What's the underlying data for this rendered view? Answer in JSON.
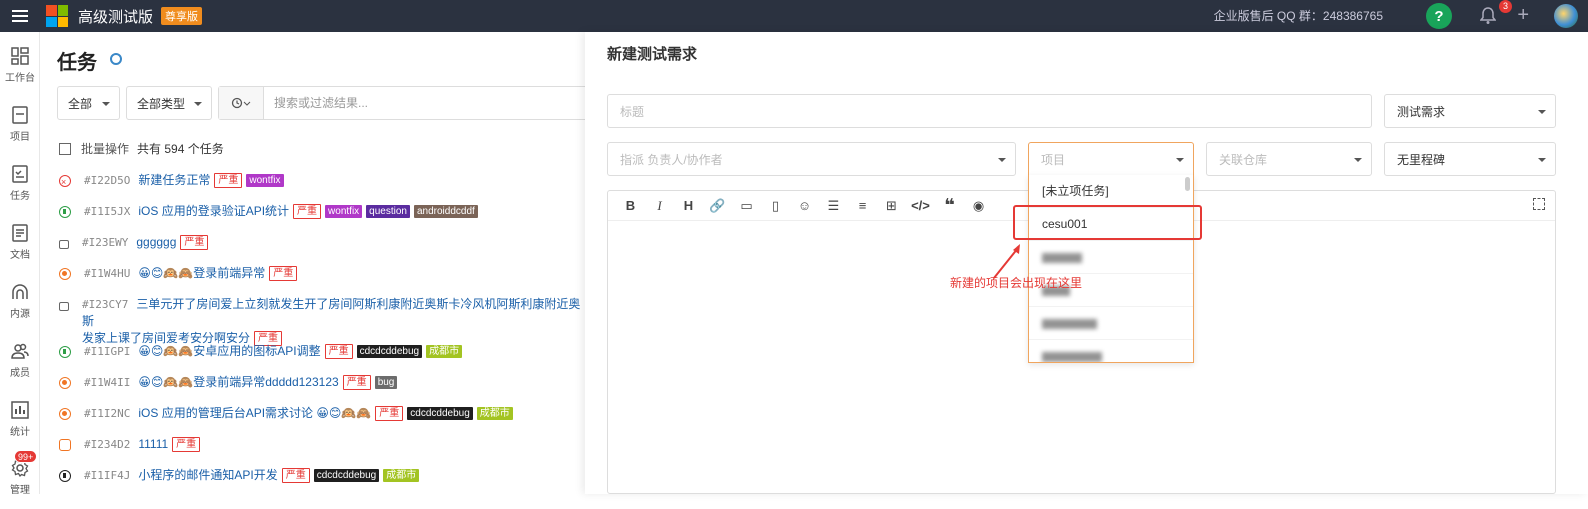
{
  "topbar": {
    "title": "高级测试版",
    "edition": "尊享版",
    "support": "企业版售后 QQ 群：248386765",
    "help": "?",
    "notifications": "3",
    "add": "+"
  },
  "sidebar": {
    "items": [
      {
        "label": "工作台",
        "icon": "dashboard-icon"
      },
      {
        "label": "项目",
        "icon": "project-icon"
      },
      {
        "label": "任务",
        "icon": "task-icon"
      },
      {
        "label": "文档",
        "icon": "doc-icon"
      },
      {
        "label": "内源",
        "icon": "innersource-icon"
      },
      {
        "label": "成员",
        "icon": "members-icon"
      },
      {
        "label": "统计",
        "icon": "stats-icon"
      },
      {
        "label": "管理",
        "icon": "gear-icon",
        "badge": "99+"
      }
    ]
  },
  "main": {
    "title": "任务",
    "filter_scope": "全部",
    "filter_type": "全部类型",
    "search_placeholder": "搜索或过滤结果...",
    "batch_label": "批量操作",
    "count_text": "共有 594 个任务",
    "tasks": [
      {
        "id": "#I22D5O",
        "title": "新建任务正常",
        "status": "rejected",
        "tags": [
          {
            "text": "严重",
            "kind": "sev"
          },
          {
            "text": "wontfix",
            "color": "#b038c8"
          }
        ]
      },
      {
        "id": "#I1I5JX",
        "title": "iOS 应用的登录验证API统计",
        "status": "progress",
        "tags": [
          {
            "text": "严重",
            "kind": "sev"
          },
          {
            "text": "wontfix",
            "color": "#b038c8"
          },
          {
            "text": "question",
            "color": "#5b2ca0"
          },
          {
            "text": "androiddcddf",
            "color": "#7b6457"
          }
        ]
      },
      {
        "id": "#I23EWY",
        "title": "gggggg",
        "status": "locked",
        "tags": [
          {
            "text": "严重",
            "kind": "sev"
          }
        ]
      },
      {
        "id": "#I1W4HU",
        "title": "😀😊🙉🙈登录前端异常",
        "status": "doing",
        "tags": [
          {
            "text": "严重",
            "kind": "sev"
          }
        ]
      },
      {
        "id": "#I23CY7",
        "title": "三单元开了房间爱上立刻就发生开了房间阿斯利康附近奥斯卡冷风机阿斯利康附近奥斯",
        "title2": "发家上课了房间爱考安分啊安分",
        "status": "locked",
        "tags": [
          {
            "text": "严重",
            "kind": "sev"
          }
        ]
      },
      {
        "id": "#I1IGPI",
        "title": "😀😊🙉🙈安卓应用的图标API调整",
        "status": "progress",
        "tags": [
          {
            "text": "严重",
            "kind": "sev"
          },
          {
            "text": "cdcdcddebug",
            "color": "#1f1f1f"
          },
          {
            "text": "成都市",
            "color": "#a3c422"
          }
        ]
      },
      {
        "id": "#I1W4II",
        "title": "😀😊🙉🙈登录前端异常ddddd123123",
        "status": "doing",
        "tags": [
          {
            "text": "严重",
            "kind": "sev"
          },
          {
            "text": "bug",
            "color": "#6c6c6c"
          }
        ]
      },
      {
        "id": "#I1I2NC",
        "title": "iOS 应用的管理后台API需求讨论 😀😊🙉🙈",
        "status": "doing",
        "tags": [
          {
            "text": "严重",
            "kind": "sev"
          },
          {
            "text": "cdcdcddebug",
            "color": "#1f1f1f"
          },
          {
            "text": "成都市",
            "color": "#a3c422"
          }
        ]
      },
      {
        "id": "#I234D2",
        "title": "11111",
        "status": "waiting",
        "tags": [
          {
            "text": "严重",
            "kind": "sev"
          }
        ]
      },
      {
        "id": "#I1IF4J",
        "title": "小程序的邮件通知API开发",
        "status": "half",
        "tags": [
          {
            "text": "严重",
            "kind": "sev"
          },
          {
            "text": "cdcdcddebug",
            "color": "#1f1f1f"
          },
          {
            "text": "成都市",
            "color": "#a3c422"
          }
        ]
      }
    ]
  },
  "panel": {
    "title": "新建测试需求",
    "title_placeholder": "标题",
    "type_value": "测试需求",
    "assignee_placeholder": "指派 负责人/协作者",
    "project_placeholder": "项目",
    "repo_placeholder": "关联仓库",
    "milestone_value": "无里程碑",
    "project_options": [
      "[未立项任务]",
      "cesu001"
    ],
    "annotation": "新建的项目会出现在这里"
  }
}
